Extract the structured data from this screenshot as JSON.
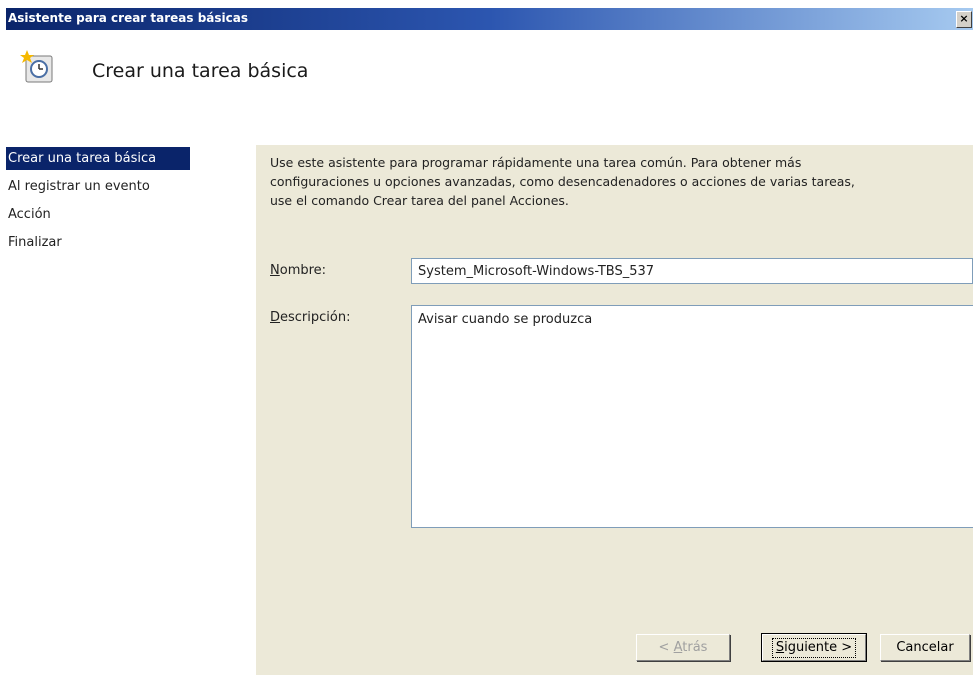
{
  "window": {
    "title": "Asistente para crear tareas básicas",
    "close_label": "×"
  },
  "header": {
    "title": "Crear una tarea básica",
    "icon": "clock-task-icon"
  },
  "nav": {
    "items": [
      {
        "label": "Crear una tarea básica",
        "active": true
      },
      {
        "label": "Al registrar un evento",
        "active": false
      },
      {
        "label": "Acción",
        "active": false
      },
      {
        "label": "Finalizar",
        "active": false
      }
    ]
  },
  "content": {
    "description_line1": "Use este asistente para programar rápidamente una tarea común. Para obtener más",
    "description_line2": "configuraciones u opciones avanzadas, como desencadenadores o acciones de varias tareas,",
    "description_line3": "use el comando Crear tarea del panel Acciones.",
    "name_label_accel": "N",
    "name_label_rest": "ombre:",
    "name_value": "System_Microsoft-Windows-TBS_537",
    "desc_label_accel": "D",
    "desc_label_rest": "escripción:",
    "desc_value": "Avisar cuando se produzca"
  },
  "buttons": {
    "back_prefix": "< ",
    "back_accel": "A",
    "back_rest": "trás",
    "next_accel": "S",
    "next_rest": "iguiente >",
    "cancel": "Cancelar"
  },
  "colors": {
    "titlebar_start": "#0a246a",
    "nav_active_bg": "#0a246a",
    "dialog_bg": "#ece9d8"
  }
}
